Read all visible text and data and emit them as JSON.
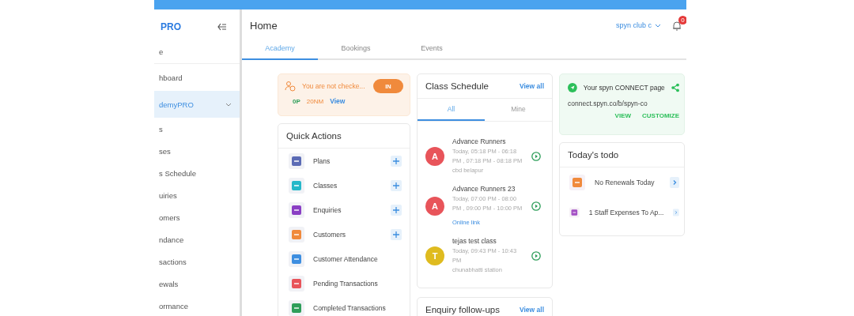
{
  "sidebar": {
    "logo": "PRO",
    "items": [
      {
        "label": "e",
        "selected": false,
        "expandable": false
      },
      {
        "label": "hboard",
        "selected": false,
        "expandable": false
      },
      {
        "label": "demyPRO",
        "selected": true,
        "expandable": true
      },
      {
        "label": "s",
        "selected": false,
        "expandable": false
      },
      {
        "label": "ses",
        "selected": false,
        "expandable": false
      },
      {
        "label": "s Schedule",
        "selected": false,
        "expandable": false
      },
      {
        "label": "uiries",
        "selected": false,
        "expandable": false
      },
      {
        "label": "omers",
        "selected": false,
        "expandable": false
      },
      {
        "label": "ndance",
        "selected": false,
        "expandable": false
      },
      {
        "label": "sactions",
        "selected": false,
        "expandable": false
      },
      {
        "label": "ewals",
        "selected": false,
        "expandable": false
      },
      {
        "label": "ormance",
        "selected": false,
        "expandable": false
      }
    ]
  },
  "header": {
    "title": "Home",
    "club": "spyn club c",
    "notifications": "0"
  },
  "tabs": [
    {
      "label": "Academy",
      "selected": true
    },
    {
      "label": "Bookings",
      "selected": false
    },
    {
      "label": "Events",
      "selected": false
    }
  ],
  "checkin": {
    "message": "You are not checke...",
    "button": "IN",
    "stat_1": "0P",
    "stat_2": "20NM",
    "link": "View"
  },
  "quick_actions": {
    "title": "Quick Actions",
    "items": [
      {
        "label": "Plans",
        "color": "#5b6bb5",
        "addable": true
      },
      {
        "label": "Classes",
        "color": "#26b8c9",
        "addable": true
      },
      {
        "label": "Enquiries",
        "color": "#8a3fc4",
        "addable": true
      },
      {
        "label": "Customers",
        "color": "#f08a3c",
        "addable": true
      },
      {
        "label": "Customer Attendance",
        "color": "#3d8ee0",
        "addable": false
      },
      {
        "label": "Pending Transactions",
        "color": "#e8545a",
        "addable": false
      },
      {
        "label": "Completed Transactions",
        "color": "#2e9e5a",
        "addable": false
      }
    ]
  },
  "class_schedule": {
    "title": "Class Schedule",
    "link": "View all",
    "tabs": [
      {
        "label": "All",
        "selected": true
      },
      {
        "label": "Mine",
        "selected": false
      }
    ],
    "classes": [
      {
        "initial": "A",
        "color": "#e8545a",
        "name": "Advance Runners",
        "time": "Today, 05:18 PM - 06:18 PM , 07:18 PM - 08:18 PM",
        "place": "cbd belapur",
        "online": false
      },
      {
        "initial": "A",
        "color": "#e8545a",
        "name": "Advance Runners 23",
        "time": "Today, 07:00 PM - 08:00 PM , 09:00 PM - 10:00 PM",
        "place": "Online link",
        "online": true
      },
      {
        "initial": "T",
        "color": "#dfbb1f",
        "name": "tejas test class",
        "time": "Today, 09:43 PM - 10:43 PM",
        "place": "chunabhatti station",
        "online": false
      }
    ]
  },
  "enquiry_followups": {
    "title": "Enquiry follow-ups",
    "link": "View all"
  },
  "connect": {
    "title": "Your spyn CONNECT page",
    "url": "connect.spyn.co/b/spyn-co",
    "actions": [
      "VIEW",
      "CUSTOMIZE"
    ]
  },
  "todo": {
    "title": "Today's todo",
    "items": [
      {
        "label": "No Renewals Today",
        "color": "#f08a3c"
      },
      {
        "label": "1 Staff Expenses To Ap...",
        "color": "#a34fc4"
      }
    ]
  }
}
